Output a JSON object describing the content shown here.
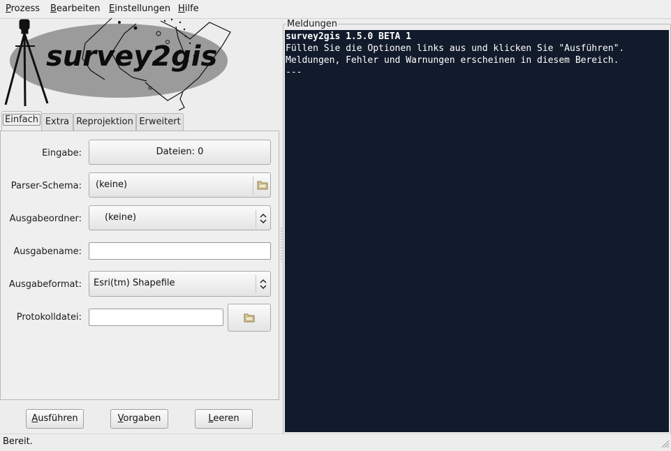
{
  "menubar": {
    "items": [
      {
        "first": "P",
        "rest": "rozess"
      },
      {
        "first": "B",
        "rest": "earbeiten"
      },
      {
        "first": "E",
        "rest": "instellungen"
      },
      {
        "first": "H",
        "rest": "ilfe"
      }
    ]
  },
  "logo": {
    "text": "survey2gis"
  },
  "tabs": [
    "Einfach",
    "Extra",
    "Reprojektion",
    "Erweitert"
  ],
  "form": {
    "eingabe_label": "Eingabe:",
    "eingabe_button": "Dateien: 0",
    "parser_label": "Parser-Schema:",
    "parser_value": "(keine)",
    "ausgabeordner_label": "Ausgabeordner:",
    "ausgabeordner_value": "(keine)",
    "ausgabename_label": "Ausgabename:",
    "ausgabename_value": "",
    "ausgabeformat_label": "Ausgabeformat:",
    "ausgabeformat_value": "Esri(tm) Shapefile",
    "protokoll_label": "Protokolldatei:",
    "protokoll_value": ""
  },
  "actions": {
    "run": {
      "first": "A",
      "rest": "usführen"
    },
    "defaults": {
      "first": "V",
      "rest": "orgaben"
    },
    "clear": {
      "first": "L",
      "rest": "eeren"
    }
  },
  "messages": {
    "frame_label": "Meldungen",
    "lines": [
      "survey2gis 1.5.0 BETA 1",
      "Füllen Sie die Optionen links aus und klicken Sie \"Ausführen\".",
      "Meldungen, Fehler und Warnungen erscheinen in diesem Bereich.",
      "---"
    ]
  },
  "status": {
    "text": "Bereit."
  },
  "icons": [
    "folder-icon",
    "chevron-updown-icon",
    "tripod-icon",
    "resize-grip-icon"
  ]
}
